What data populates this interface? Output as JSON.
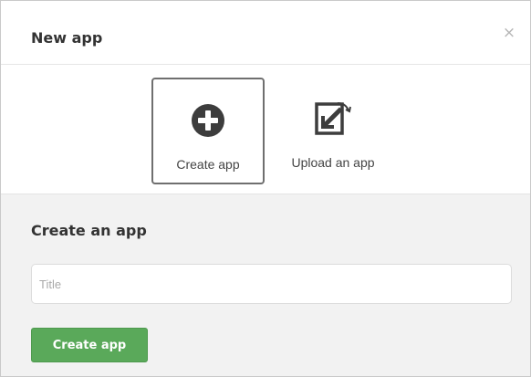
{
  "dialog": {
    "title": "New app",
    "close_glyph": "×"
  },
  "choices": [
    {
      "label": "Create app",
      "icon": "plus-circle-icon",
      "selected": true
    },
    {
      "label": "Upload an app",
      "icon": "upload-icon",
      "selected": false
    }
  ],
  "form": {
    "heading": "Create an app",
    "title_placeholder": "Title",
    "title_value": "",
    "submit_label": "Create app"
  },
  "colors": {
    "primary_button": "#5aa95a",
    "section_background": "#f2f2f2",
    "selected_border": "#6f6f6f",
    "icon": "#3d3d3d"
  }
}
